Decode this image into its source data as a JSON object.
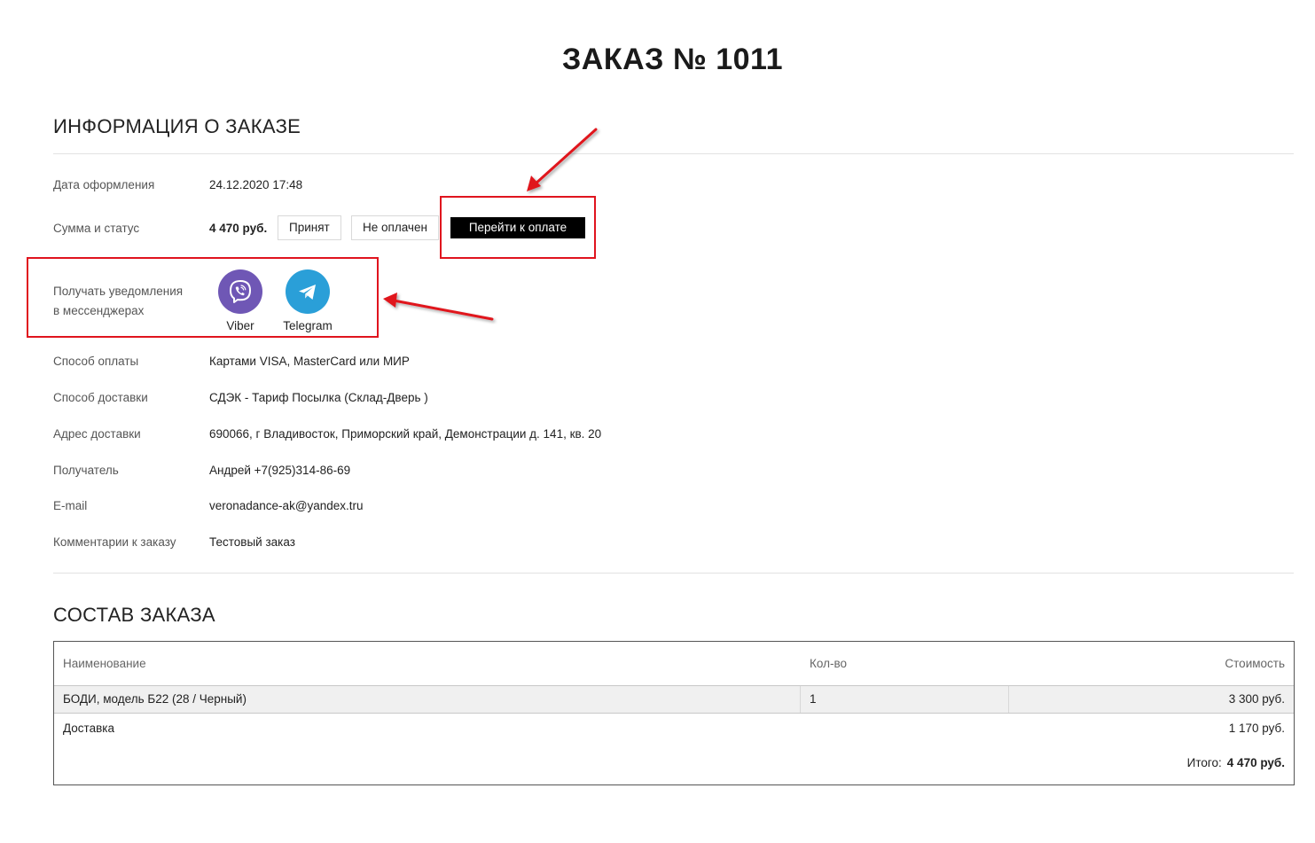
{
  "page": {
    "title": "ЗАКАЗ № 1011"
  },
  "info_section": {
    "title": "ИНФОРМАЦИЯ О ЗАКАЗЕ",
    "date_label": "Дата оформления",
    "date_value": "24.12.2020 17:48",
    "sum_label": "Сумма и статус",
    "amount": "4 470 руб.",
    "status_accepted": "Принят",
    "status_unpaid": "Не оплачен",
    "pay_button": "Перейти к оплате",
    "notify_label_line1": "Получать уведомления",
    "notify_label_line2": "в мессенджерах",
    "messengers": [
      {
        "name": "Viber",
        "icon": "viber-icon",
        "color": "#7360f2"
      },
      {
        "name": "Telegram",
        "icon": "telegram-icon",
        "color": "#2ca5e0"
      }
    ],
    "payment_label": "Способ оплаты",
    "payment_value": "Картами VISA, MasterCard или МИР",
    "delivery_label": "Способ доставки",
    "delivery_value": "СДЭК - Тариф Посылка (Склад-Дверь )",
    "address_label": "Адрес доставки",
    "address_value": "690066, г Владивосток, Приморский край, Демонстрации д. 141, кв. 20",
    "recipient_label": "Получатель",
    "recipient_value": "Андрей +7(925)314-86-69",
    "email_label": "E-mail",
    "email_value": "veronadance-ak@yandex.tru",
    "comment_label": "Комментарии к заказу",
    "comment_value": "Тестовый заказ"
  },
  "order_section": {
    "title": "СОСТАВ ЗАКАЗА",
    "columns": {
      "name": "Наименование",
      "qty": "Кол-во",
      "price": "Стоимость"
    },
    "items": [
      {
        "name": "БОДИ, модель Б22 (28 / Черный)",
        "qty": "1",
        "price": "3 300 руб."
      }
    ],
    "delivery_row": {
      "name": "Доставка",
      "price": "1 170 руб."
    },
    "total_label": "Итого:",
    "total_value": "4 470 руб."
  },
  "colors": {
    "annotation": "#e0141e",
    "pay_button_bg": "#000000"
  }
}
